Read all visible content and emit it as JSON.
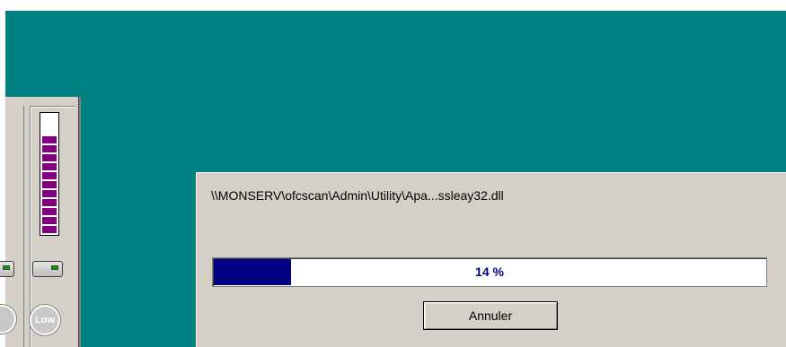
{
  "dialog": {
    "file_path": "\\\\MONSERV\\ofcscan\\Admin\\Utility\\Apa...ssleay32.dll",
    "progress_percent": 14,
    "progress_label": "14 %",
    "cancel_label": "Annuler"
  },
  "monitor": {
    "meter_segments_filled": 11,
    "low_icon_label": "Low"
  },
  "colors": {
    "desktop": "#008080",
    "window_face": "#d4d0c8",
    "progress_fill": "#000080",
    "meter_fill": "#800080"
  },
  "icons": {
    "drive": "drive-icon",
    "low": "low-priority-icon",
    "circle": "circle-icon"
  }
}
